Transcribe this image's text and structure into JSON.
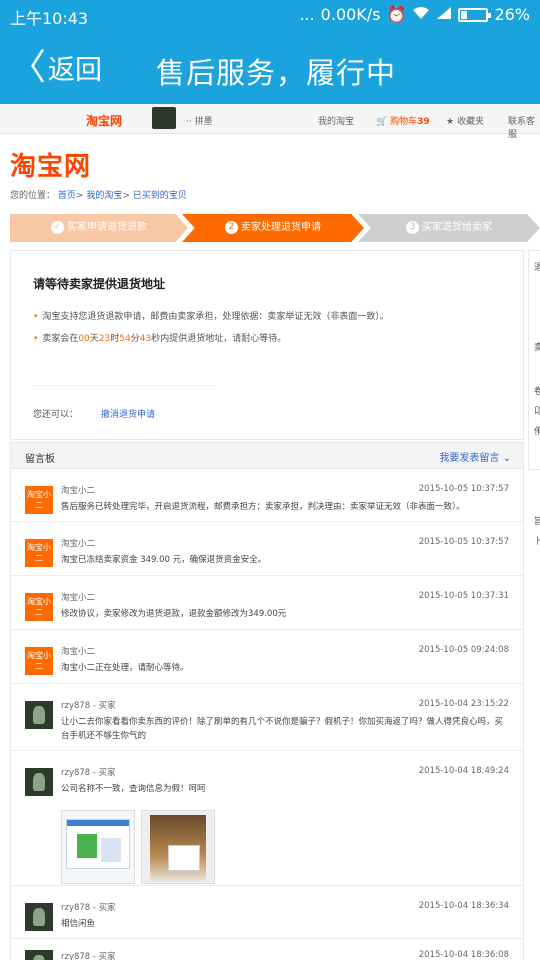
{
  "status": {
    "time": "上午10:43",
    "dots": "...",
    "speed": "0.00K/s",
    "alarm_icon": "alarm-icon",
    "wifi_icon": "wifi-icon",
    "signal_icon": "signal-icon",
    "battery_level": 0.26,
    "battery": "26%"
  },
  "titlebar": {
    "back_label": "返回",
    "back_glyph": "〈",
    "title": "售后服务，履行中"
  },
  "topnav": {
    "logo": "淘宝网",
    "username": "·· 拼墨",
    "my_taobao": "我的淘宝",
    "cart_label": "购物车",
    "cart_count": "39",
    "favorites": "收藏夹",
    "contact": "联系客服"
  },
  "page": {
    "logo": "淘宝网",
    "breadcrumb_prefix": "您的位置：",
    "breadcrumb": [
      "首页",
      "我的淘宝",
      "已买到的宝贝"
    ]
  },
  "steps": [
    {
      "num": "✓",
      "label": "买家申请退货退款",
      "state": "done"
    },
    {
      "num": "2",
      "label": "卖家处理退货申请",
      "state": "current"
    },
    {
      "num": "3",
      "label": "买家退货给卖家",
      "state": "todo"
    }
  ],
  "card": {
    "heading": "请等待卖家提供退货地址",
    "line1": "淘宝支持您退货退款申请，邮费由卖家承担，处理依据：卖家举证无效（非表面一致）。",
    "line2_prefix": "卖家会在",
    "countdown": {
      "days": "00",
      "d_unit": "天",
      "hours": "23",
      "h_unit": "时",
      "minutes": "54",
      "m_unit": "分",
      "seconds": "43",
      "s_unit": "秒"
    },
    "line2_suffix": "内提供退货地址，请耐心等待。",
    "also_label": "您还可以：",
    "cancel_label": "撤消退货申请"
  },
  "side": {
    "chars": [
      "退",
      "卖",
      "卷",
      "卬",
      "侑",
      "旨",
      "卜"
    ]
  },
  "board": {
    "title": "留言板",
    "post_label": "我要发表留言",
    "messages": [
      {
        "name": "淘宝小二",
        "time": "2015-10-05 10:37:57",
        "text": "售后服务已转处理完毕，开启退货流程，邮费承担方：卖家承担，判决理由：卖家举证无效（非表面一致）。",
        "type": "xiaoer"
      },
      {
        "name": "淘宝小二",
        "time": "2015-10-05 10:37:57",
        "text": "淘宝已冻结卖家资金 349.00 元，确保退货资金安全。",
        "type": "xiaoer"
      },
      {
        "name": "淘宝小二",
        "time": "2015-10-05 10:37:31",
        "text": "修改协议，卖家修改为退货退款，退款金额修改为349.00元",
        "type": "xiaoer"
      },
      {
        "name": "淘宝小二",
        "time": "2015-10-05 09:24:08",
        "text": "淘宝小二正在处理，请耐心等待。",
        "type": "xiaoer"
      },
      {
        "name": "rzy878 - 买家",
        "time": "2015-10-04 23:15:22",
        "text": "让小二去你家看看你卖东西的评价！除了刷单的有几个不说你是骗子？假机子！你加买海返了吗？做人得凭良心吗，买台手机还不够生你气的",
        "type": "user"
      },
      {
        "name": "rzy878 - 买家",
        "time": "2015-10-04 18:49:24",
        "text": "公司名称不一致，查询信息为假！呵呵",
        "type": "user"
      },
      {
        "name": "rzy878 - 买家",
        "time": "2015-10-04 18:36:34",
        "text": "相信闲鱼",
        "type": "user"
      },
      {
        "name": "rzy878 - 买家",
        "time": "2015-10-04 18:36:08",
        "text": "",
        "type": "user"
      }
    ],
    "xiaoer_avatar": "淘宝小二"
  },
  "colors": {
    "brand_blue": "#1aa3dd",
    "taobao_orange": "#ff6a00",
    "link": "#3366cc"
  }
}
